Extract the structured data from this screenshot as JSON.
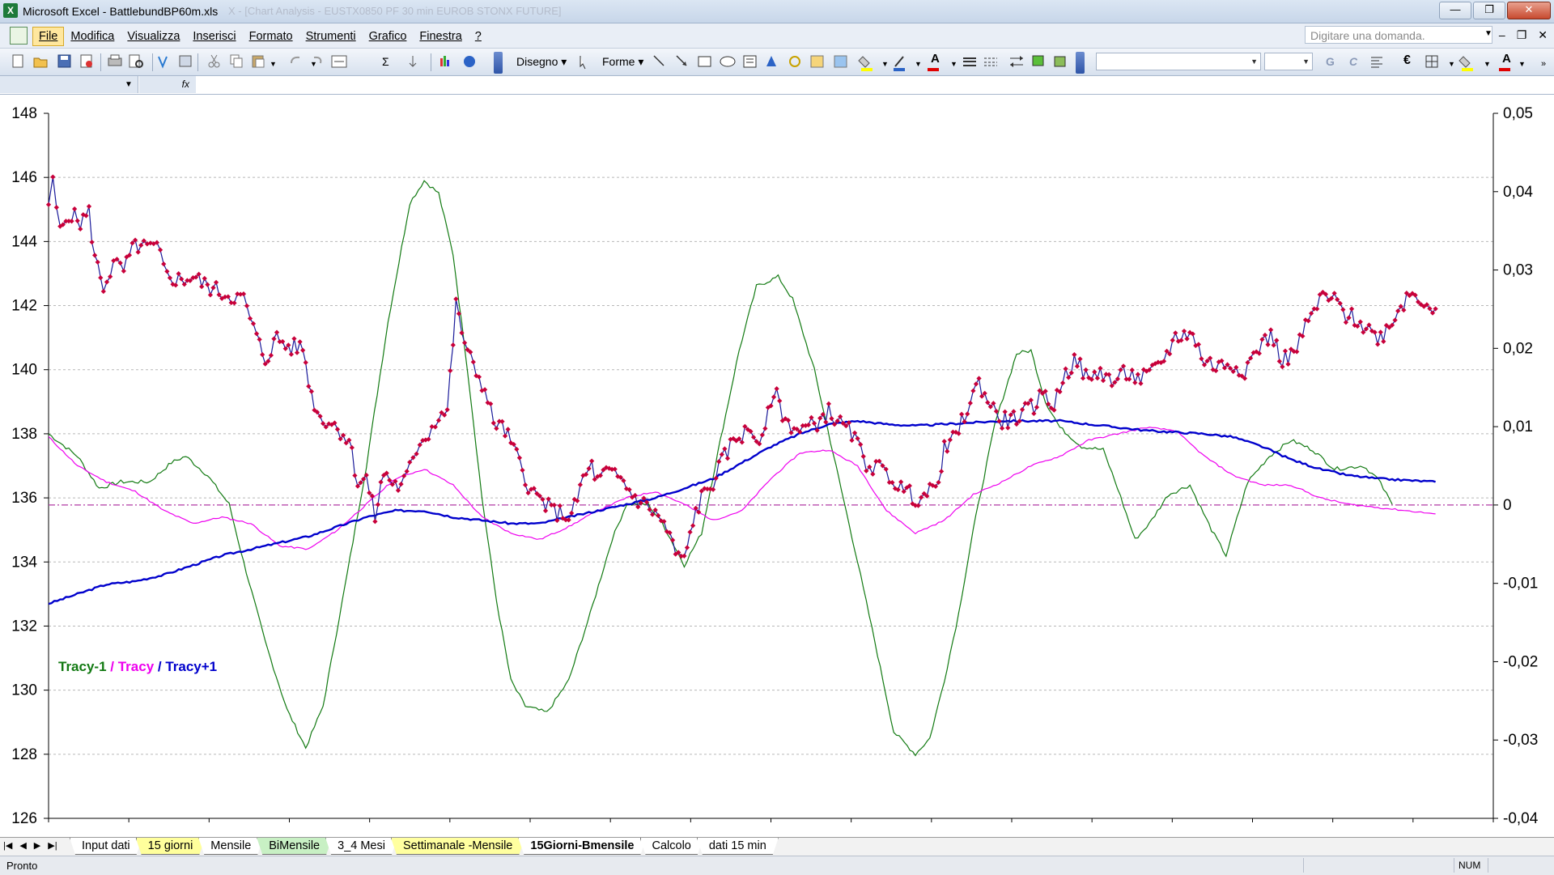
{
  "window": {
    "title": "Microsoft Excel - BattlebundBP60m.xls",
    "ghost_text": "X - [Chart Analysis - EUSTX0850 PF 30 min  EUROB STONX FUTURE]",
    "minimize": "—",
    "restore": "❐",
    "close": "✕"
  },
  "menu": {
    "items": [
      "File",
      "Modifica",
      "Visualizza",
      "Inserisci",
      "Formato",
      "Strumenti",
      "Grafico",
      "Finestra",
      "?"
    ],
    "help_placeholder": "Digitare una domanda.",
    "doc_min": "–",
    "doc_restore": "❐",
    "doc_close": "✕"
  },
  "toolbar": {
    "disegno": "Disegno",
    "forme": "Forme",
    "bold": "G",
    "italic": "C",
    "euro": "€",
    "font_color_letter": "A",
    "sigma": "Σ",
    "sort": "↓",
    "fx": "fx"
  },
  "sheet_tabs": [
    "Input dati",
    "15 giorni",
    "Mensile",
    "BiMensile",
    "3_4 Mesi",
    "Settimanale -Mensile",
    "15Giorni-Bmensile",
    "Calcolo",
    "dati 15 min"
  ],
  "status": {
    "text": "Pronto",
    "num": "NUM"
  },
  "chart_data": {
    "type": "line",
    "legend": [
      {
        "name": "Tracy-1",
        "color": "#127a12"
      },
      {
        "name": "Tracy",
        "color": "#ee00ee"
      },
      {
        "name": "Tracy+1",
        "color": "#0000cc"
      }
    ],
    "legend_separator": "/",
    "legend_placement": "left",
    "y_left": {
      "min": 126,
      "max": 148,
      "ticks": [
        "126",
        "128",
        "130",
        "132",
        "134",
        "136",
        "138",
        "140",
        "142",
        "144",
        "146",
        "148"
      ]
    },
    "y_right": {
      "min": -0.04,
      "max": 0.05,
      "ticks": [
        "-0,04",
        "-0,03",
        "-0,02",
        "-0,01",
        "0",
        "0,01",
        "0,02",
        "0,03",
        "0,04",
        "0,05"
      ]
    },
    "x_range": [
      0,
      1000
    ],
    "grid": true,
    "zero_line_color": "#b03aa3",
    "price_color": "#1a1a9a",
    "marker_color": "#c8003a",
    "price_anchors": [
      [
        0,
        145.2
      ],
      [
        3,
        145.8
      ],
      [
        8,
        144.3
      ],
      [
        14,
        144.9
      ],
      [
        22,
        144.6
      ],
      [
        28,
        144.9
      ],
      [
        32,
        143.5
      ],
      [
        38,
        142.6
      ],
      [
        45,
        143.3
      ],
      [
        52,
        143.1
      ],
      [
        60,
        143.9
      ],
      [
        66,
        143.8
      ],
      [
        75,
        143.8
      ],
      [
        82,
        142.9
      ],
      [
        92,
        142.8
      ],
      [
        100,
        142.9
      ],
      [
        110,
        142.6
      ],
      [
        120,
        142.4
      ],
      [
        135,
        142.2
      ],
      [
        144,
        141.0
      ],
      [
        150,
        140.3
      ],
      [
        158,
        141.0
      ],
      [
        166,
        140.7
      ],
      [
        176,
        140.7
      ],
      [
        182,
        139.2
      ],
      [
        188,
        138.5
      ],
      [
        194,
        138.4
      ],
      [
        200,
        138.2
      ],
      [
        208,
        137.8
      ],
      [
        214,
        136.5
      ],
      [
        220,
        136.6
      ],
      [
        226,
        135.4
      ],
      [
        232,
        136.8
      ],
      [
        238,
        136.5
      ],
      [
        244,
        136.3
      ],
      [
        250,
        136.9
      ],
      [
        257,
        137.8
      ],
      [
        263,
        138.0
      ],
      [
        270,
        138.6
      ],
      [
        276,
        138.7
      ],
      [
        282,
        142.0
      ],
      [
        290,
        140.5
      ],
      [
        300,
        139.6
      ],
      [
        308,
        138.4
      ],
      [
        316,
        138.1
      ],
      [
        326,
        137.1
      ],
      [
        334,
        136.2
      ],
      [
        342,
        135.9
      ],
      [
        348,
        135.6
      ],
      [
        356,
        135.5
      ],
      [
        362,
        135.4
      ],
      [
        370,
        136.6
      ],
      [
        376,
        137.0
      ],
      [
        380,
        136.5
      ],
      [
        386,
        136.8
      ],
      [
        396,
        136.6
      ],
      [
        406,
        136.0
      ],
      [
        416,
        135.7
      ],
      [
        426,
        135.2
      ],
      [
        434,
        134.3
      ],
      [
        440,
        134.0
      ],
      [
        446,
        135.3
      ],
      [
        452,
        136.0
      ],
      [
        460,
        136.5
      ],
      [
        468,
        137.3
      ],
      [
        476,
        137.9
      ],
      [
        486,
        138.1
      ],
      [
        494,
        137.7
      ],
      [
        502,
        139.4
      ],
      [
        510,
        138.4
      ],
      [
        520,
        138.1
      ],
      [
        530,
        138.3
      ],
      [
        540,
        138.7
      ],
      [
        548,
        138.3
      ],
      [
        556,
        138.0
      ],
      [
        566,
        137.1
      ],
      [
        575,
        136.9
      ],
      [
        582,
        136.7
      ],
      [
        590,
        136.3
      ],
      [
        600,
        136.0
      ],
      [
        608,
        136.1
      ],
      [
        614,
        136.3
      ],
      [
        620,
        137.5
      ],
      [
        628,
        137.9
      ],
      [
        636,
        138.8
      ],
      [
        644,
        139.6
      ],
      [
        652,
        138.9
      ],
      [
        660,
        138.4
      ],
      [
        670,
        138.5
      ],
      [
        680,
        138.8
      ],
      [
        690,
        139.3
      ],
      [
        696,
        138.8
      ],
      [
        702,
        139.8
      ],
      [
        712,
        140.3
      ],
      [
        720,
        139.6
      ],
      [
        728,
        140.0
      ],
      [
        736,
        139.6
      ],
      [
        746,
        139.9
      ],
      [
        756,
        139.7
      ],
      [
        764,
        139.9
      ],
      [
        770,
        140.2
      ],
      [
        780,
        141.0
      ],
      [
        790,
        141.2
      ],
      [
        800,
        140.3
      ],
      [
        808,
        140.1
      ],
      [
        818,
        140.2
      ],
      [
        828,
        140.0
      ],
      [
        836,
        140.6
      ],
      [
        846,
        141.1
      ],
      [
        854,
        140.3
      ],
      [
        862,
        140.5
      ],
      [
        872,
        141.5
      ],
      [
        882,
        142.3
      ],
      [
        892,
        142.1
      ],
      [
        898,
        141.7
      ],
      [
        904,
        141.6
      ],
      [
        912,
        141.3
      ],
      [
        922,
        141.0
      ],
      [
        932,
        141.7
      ],
      [
        942,
        142.4
      ],
      [
        948,
        142.3
      ],
      [
        954,
        142.1
      ],
      [
        960,
        141.9
      ]
    ],
    "tracy_plus1_anchors": [
      [
        0,
        132.7
      ],
      [
        20,
        133.0
      ],
      [
        40,
        133.3
      ],
      [
        60,
        133.4
      ],
      [
        80,
        133.6
      ],
      [
        100,
        133.9
      ],
      [
        120,
        134.2
      ],
      [
        140,
        134.4
      ],
      [
        160,
        134.6
      ],
      [
        180,
        134.8
      ],
      [
        200,
        135.1
      ],
      [
        220,
        135.4
      ],
      [
        240,
        135.6
      ],
      [
        260,
        135.6
      ],
      [
        280,
        135.4
      ],
      [
        300,
        135.3
      ],
      [
        320,
        135.2
      ],
      [
        340,
        135.2
      ],
      [
        360,
        135.4
      ],
      [
        380,
        135.6
      ],
      [
        400,
        135.8
      ],
      [
        420,
        136.0
      ],
      [
        440,
        136.3
      ],
      [
        460,
        136.6
      ],
      [
        480,
        137.1
      ],
      [
        500,
        137.6
      ],
      [
        520,
        138.0
      ],
      [
        540,
        138.3
      ],
      [
        560,
        138.4
      ],
      [
        580,
        138.3
      ],
      [
        600,
        138.25
      ],
      [
        620,
        138.3
      ],
      [
        640,
        138.35
      ],
      [
        660,
        138.4
      ],
      [
        680,
        138.4
      ],
      [
        700,
        138.4
      ],
      [
        720,
        138.3
      ],
      [
        740,
        138.2
      ],
      [
        760,
        138.1
      ],
      [
        780,
        138.05
      ],
      [
        800,
        138.0
      ],
      [
        820,
        137.9
      ],
      [
        840,
        137.6
      ],
      [
        860,
        137.2
      ],
      [
        880,
        136.9
      ],
      [
        900,
        136.7
      ],
      [
        920,
        136.6
      ],
      [
        960,
        136.5
      ]
    ],
    "tracy_anchors": [
      [
        0,
        137.9
      ],
      [
        20,
        137.0
      ],
      [
        40,
        136.5
      ],
      [
        60,
        136.2
      ],
      [
        80,
        135.6
      ],
      [
        100,
        135.2
      ],
      [
        120,
        135.4
      ],
      [
        140,
        135.2
      ],
      [
        160,
        134.5
      ],
      [
        180,
        134.4
      ],
      [
        200,
        135.0
      ],
      [
        220,
        135.8
      ],
      [
        240,
        136.6
      ],
      [
        260,
        136.9
      ],
      [
        280,
        136.4
      ],
      [
        300,
        135.4
      ],
      [
        320,
        134.9
      ],
      [
        340,
        134.7
      ],
      [
        360,
        135.1
      ],
      [
        380,
        135.6
      ],
      [
        400,
        136.0
      ],
      [
        420,
        136.2
      ],
      [
        440,
        135.8
      ],
      [
        460,
        135.3
      ],
      [
        480,
        135.6
      ],
      [
        500,
        136.6
      ],
      [
        520,
        137.4
      ],
      [
        540,
        137.5
      ],
      [
        560,
        137.0
      ],
      [
        580,
        135.6
      ],
      [
        600,
        134.9
      ],
      [
        620,
        135.3
      ],
      [
        640,
        136.1
      ],
      [
        660,
        136.5
      ],
      [
        680,
        137.0
      ],
      [
        700,
        137.3
      ],
      [
        720,
        137.8
      ],
      [
        740,
        138.0
      ],
      [
        760,
        138.2
      ],
      [
        780,
        138.1
      ],
      [
        800,
        137.3
      ],
      [
        820,
        136.7
      ],
      [
        840,
        136.4
      ],
      [
        860,
        136.4
      ],
      [
        880,
        136.0
      ],
      [
        900,
        135.8
      ],
      [
        920,
        135.7
      ],
      [
        940,
        135.6
      ],
      [
        960,
        135.5
      ]
    ],
    "tracy_minus1_anchors": [
      [
        0,
        138.0
      ],
      [
        20,
        137.3
      ],
      [
        35,
        136.3
      ],
      [
        50,
        136.5
      ],
      [
        70,
        136.5
      ],
      [
        85,
        137.1
      ],
      [
        95,
        137.3
      ],
      [
        110,
        136.7
      ],
      [
        125,
        135.8
      ],
      [
        135,
        134.0
      ],
      [
        150,
        131.5
      ],
      [
        165,
        129.4
      ],
      [
        178,
        128.2
      ],
      [
        190,
        129.5
      ],
      [
        205,
        133.2
      ],
      [
        220,
        137.0
      ],
      [
        235,
        141.5
      ],
      [
        250,
        145.2
      ],
      [
        260,
        145.9
      ],
      [
        270,
        145.5
      ],
      [
        280,
        143.6
      ],
      [
        290,
        140.0
      ],
      [
        300,
        136.0
      ],
      [
        310,
        132.8
      ],
      [
        320,
        130.3
      ],
      [
        330,
        129.5
      ],
      [
        345,
        129.3
      ],
      [
        360,
        130.3
      ],
      [
        375,
        132.4
      ],
      [
        390,
        134.7
      ],
      [
        400,
        135.8
      ],
      [
        415,
        135.8
      ],
      [
        425,
        135.2
      ],
      [
        440,
        133.9
      ],
      [
        452,
        134.9
      ],
      [
        465,
        137.8
      ],
      [
        478,
        140.6
      ],
      [
        490,
        142.6
      ],
      [
        505,
        142.9
      ],
      [
        515,
        142.2
      ],
      [
        530,
        140.0
      ],
      [
        545,
        137.0
      ],
      [
        560,
        134.0
      ],
      [
        572,
        131.5
      ],
      [
        585,
        128.7
      ],
      [
        600,
        128.0
      ],
      [
        610,
        128.5
      ],
      [
        620,
        130.3
      ],
      [
        630,
        132.4
      ],
      [
        640,
        135.0
      ],
      [
        655,
        138.3
      ],
      [
        670,
        140.5
      ],
      [
        680,
        140.6
      ],
      [
        690,
        139.0
      ],
      [
        700,
        138.2
      ],
      [
        715,
        137.6
      ],
      [
        730,
        137.5
      ],
      [
        740,
        136.3
      ],
      [
        752,
        134.7
      ],
      [
        762,
        135.2
      ],
      [
        775,
        136.1
      ],
      [
        790,
        136.4
      ],
      [
        805,
        135.0
      ],
      [
        815,
        134.2
      ],
      [
        830,
        136.5
      ],
      [
        845,
        137.3
      ],
      [
        860,
        137.8
      ],
      [
        875,
        137.5
      ],
      [
        890,
        136.9
      ],
      [
        910,
        137.0
      ],
      [
        920,
        136.6
      ],
      [
        930,
        135.8
      ]
    ]
  }
}
